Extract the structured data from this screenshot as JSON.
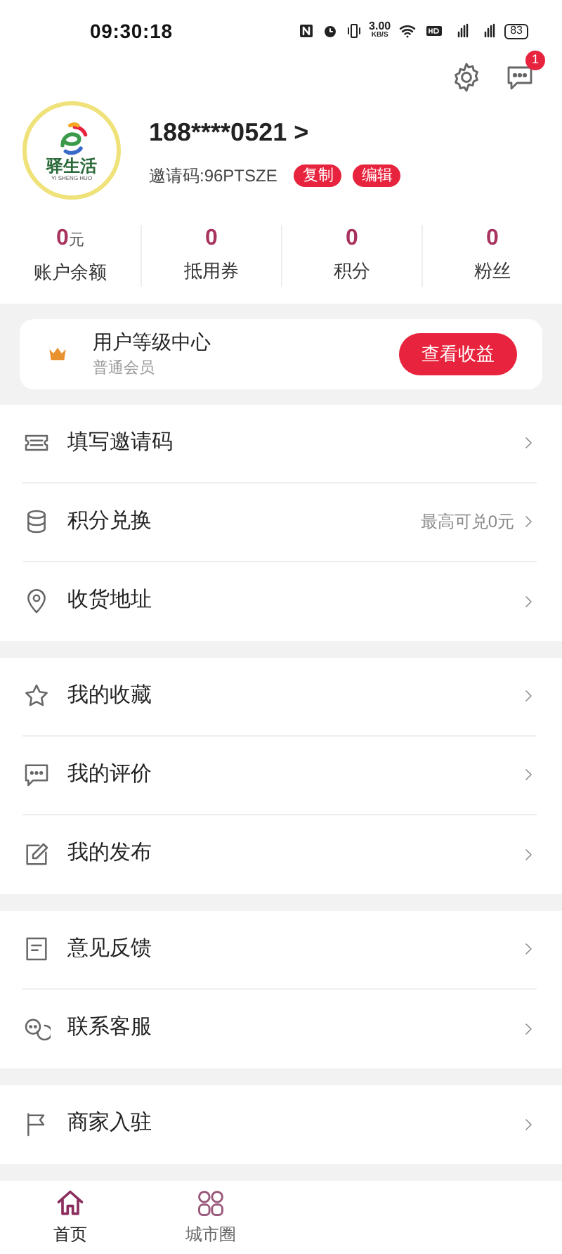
{
  "status_bar": {
    "time": "09:30:18",
    "speed": "3.00",
    "speed_unit": "KB/S",
    "battery": "83"
  },
  "header": {
    "message_badge": "1"
  },
  "profile": {
    "logo_text": "驿生活",
    "logo_subtext": "YI SHENG HUO",
    "phone": "188****0521 >",
    "invite_code": "邀请码:96PTSZE",
    "actions": [
      "复制",
      "编辑"
    ]
  },
  "stats": [
    {
      "value": "0",
      "unit": "元",
      "label": "账户余额"
    },
    {
      "value": "0",
      "label": "抵用券"
    },
    {
      "value": "0",
      "label": "积分"
    },
    {
      "value": "0",
      "label": "粉丝"
    }
  ],
  "level_card": {
    "title": "用户等级中心",
    "subtitle": "普通会员",
    "button": "查看收益"
  },
  "menu_groups": [
    [
      {
        "label": "填写邀请码"
      },
      {
        "label": "积分兑换",
        "note": "最高可兑0元"
      },
      {
        "label": "收货地址"
      }
    ],
    [
      {
        "label": "我的收藏"
      },
      {
        "label": "我的评价"
      },
      {
        "label": "我的发布"
      }
    ],
    [
      {
        "label": "意见反馈"
      },
      {
        "label": "联系客服"
      }
    ],
    [
      {
        "label": "商家入驻"
      }
    ]
  ],
  "tab_bar": [
    {
      "label": "首页",
      "selected": true
    },
    {
      "label": "城市圈",
      "selected": false
    }
  ]
}
